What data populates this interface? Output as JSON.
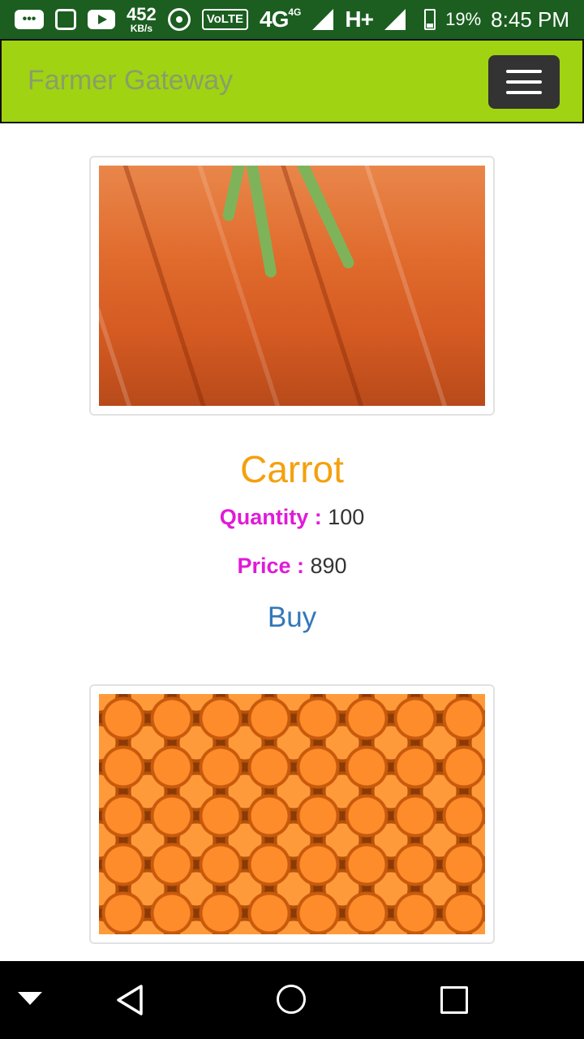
{
  "status_bar": {
    "net_speed_value": "452",
    "net_speed_unit": "KB/s",
    "volte": "VoLTE",
    "network_4g": "4G",
    "network_4g_sup": "4G",
    "network_h": "H+",
    "battery_percent": "19%",
    "time": "8:45 PM"
  },
  "navbar": {
    "brand": "Farmer Gateway"
  },
  "products": [
    {
      "name": "Carrot",
      "quantity_label": "Quantity :",
      "quantity": "100",
      "price_label": "Price :",
      "price": "890",
      "buy_label": "Buy"
    }
  ],
  "colors": {
    "navbar_bg": "#a0d312",
    "product_name": "#f5a00c",
    "detail_label": "#e01ad8",
    "buy_link": "#3378b8"
  }
}
